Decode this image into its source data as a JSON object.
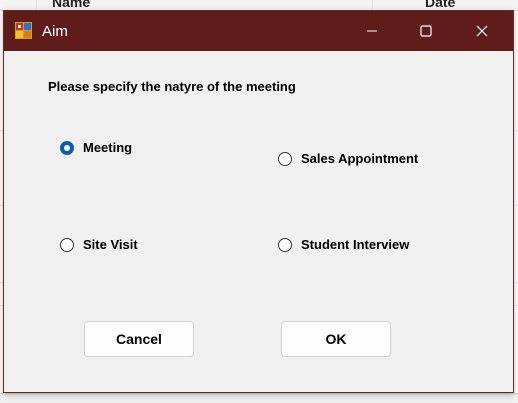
{
  "background": {
    "columns": [
      "Name",
      "Date"
    ]
  },
  "dialog": {
    "title": "Aim",
    "prompt": "Please specify the natyre of the meeting",
    "options": [
      {
        "label": "Meeting",
        "checked": true
      },
      {
        "label": "Sales Appointment",
        "checked": false
      },
      {
        "label": "Site Visit",
        "checked": false
      },
      {
        "label": "Student Interview",
        "checked": false
      }
    ],
    "buttons": {
      "cancel": "Cancel",
      "ok": "OK"
    },
    "window_controls": [
      "minimize-icon",
      "maximize-icon",
      "close-icon"
    ]
  },
  "colors": {
    "titlebar": "#5e1c1b",
    "dialog_bg": "#f0f0f0",
    "radio_checked": "#0a5fb4"
  }
}
